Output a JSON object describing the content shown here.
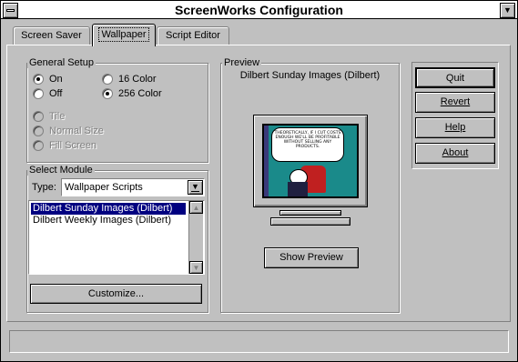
{
  "window": {
    "title": "ScreenWorks Configuration"
  },
  "tabs": [
    {
      "label": "Screen Saver"
    },
    {
      "label": "Wallpaper"
    },
    {
      "label": "Script Editor"
    }
  ],
  "general_setup": {
    "label": "General Setup",
    "on": "On",
    "off": "Off",
    "color16": "16 Color",
    "color256": "256 Color",
    "tile": "Tile",
    "normal": "Normal Size",
    "fill": "Fill Screen"
  },
  "select_module": {
    "label": "Select Module",
    "type_label": "Type:",
    "type_value": "Wallpaper Scripts",
    "items": [
      "Dilbert Sunday Images (Dilbert)",
      "Dilbert Weekly Images (Dilbert)"
    ],
    "customize": "Customize..."
  },
  "preview": {
    "label": "Preview",
    "caption": "Dilbert Sunday Images (Dilbert)",
    "comic_text": "THEORETICALLY, IF I CUT COSTS ENOUGH WE'LL BE PROFITABLE WITHOUT SELLING ANY PRODUCTS.",
    "show_preview": "Show Preview"
  },
  "buttons": {
    "quit": "Quit",
    "revert": "Revert",
    "help": "Help",
    "about": "About"
  },
  "status": {
    "text": ""
  },
  "colors": {
    "selection": "#000080",
    "face": "#c0c0c0",
    "preview_bg": "#1a8a8a"
  }
}
